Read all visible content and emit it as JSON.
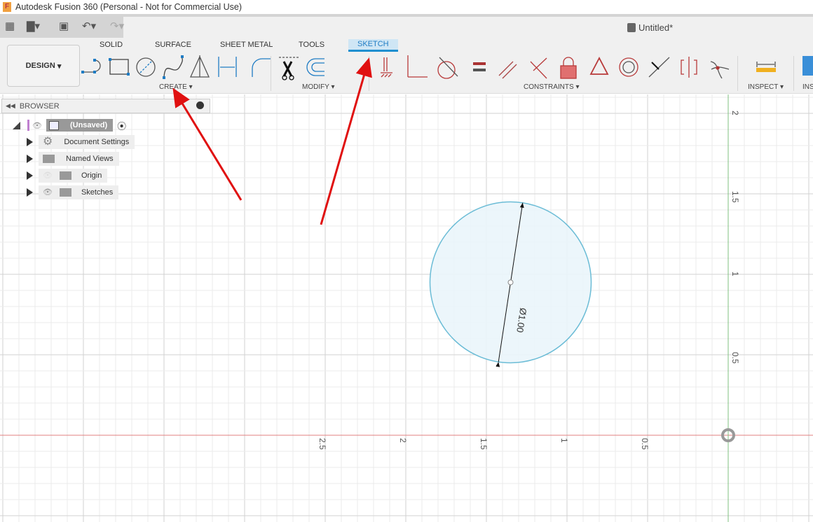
{
  "window": {
    "title": "Autodesk Fusion 360 (Personal - Not for Commercial Use)",
    "document": "Untitled*"
  },
  "workspace": {
    "label": "DESIGN"
  },
  "tabs": [
    {
      "label": "SOLID"
    },
    {
      "label": "SURFACE"
    },
    {
      "label": "SHEET METAL"
    },
    {
      "label": "TOOLS"
    },
    {
      "label": "SKETCH",
      "active": true
    }
  ],
  "groups": {
    "create": "CREATE",
    "modify": "MODIFY",
    "constraints": "CONSTRAINTS",
    "inspect": "INSPECT",
    "insert": "INS"
  },
  "icons": {
    "create": [
      "line-icon",
      "rectangle-icon",
      "circle-icon",
      "spline-icon",
      "mirror-icon",
      "dimension-icon"
    ],
    "modify": [
      "fillet-icon",
      "trim-icon",
      "offset-icon"
    ],
    "constraints": [
      "fix-icon",
      "coincident-icon",
      "tangent-icon",
      "equal-icon",
      "parallel-icon",
      "perpendicular-icon",
      "lock-icon",
      "midpoint-icon",
      "concentric-icon",
      "collinear-icon",
      "symmetry-icon",
      "curvature-icon"
    ],
    "inspect": [
      "measure-icon"
    ]
  },
  "browser": {
    "title": "BROWSER",
    "root": "(Unsaved)",
    "items": [
      {
        "label": "Document Settings",
        "icon": "gear-icon"
      },
      {
        "label": "Named Views",
        "icon": "folder-icon"
      },
      {
        "label": "Origin",
        "icon": "folder-icon",
        "hidden": true
      },
      {
        "label": "Sketches",
        "icon": "folder-icon"
      }
    ]
  },
  "canvas": {
    "x_axis_labels": [
      "2.5",
      "2",
      "1.5",
      "1",
      "0.5"
    ],
    "y_axis_labels": [
      "2",
      "1.5",
      "1",
      "0.5"
    ],
    "dimension": "Ø1.00",
    "circle_diameter": 1.0,
    "circle_center": [
      1.35,
      0.95
    ],
    "colors": {
      "circle": "#6bbcd6",
      "x_axis": "#e08080",
      "y_axis": "#80c080",
      "annotation_arrow": "#e01010",
      "accent": "#1f7cc4"
    }
  }
}
